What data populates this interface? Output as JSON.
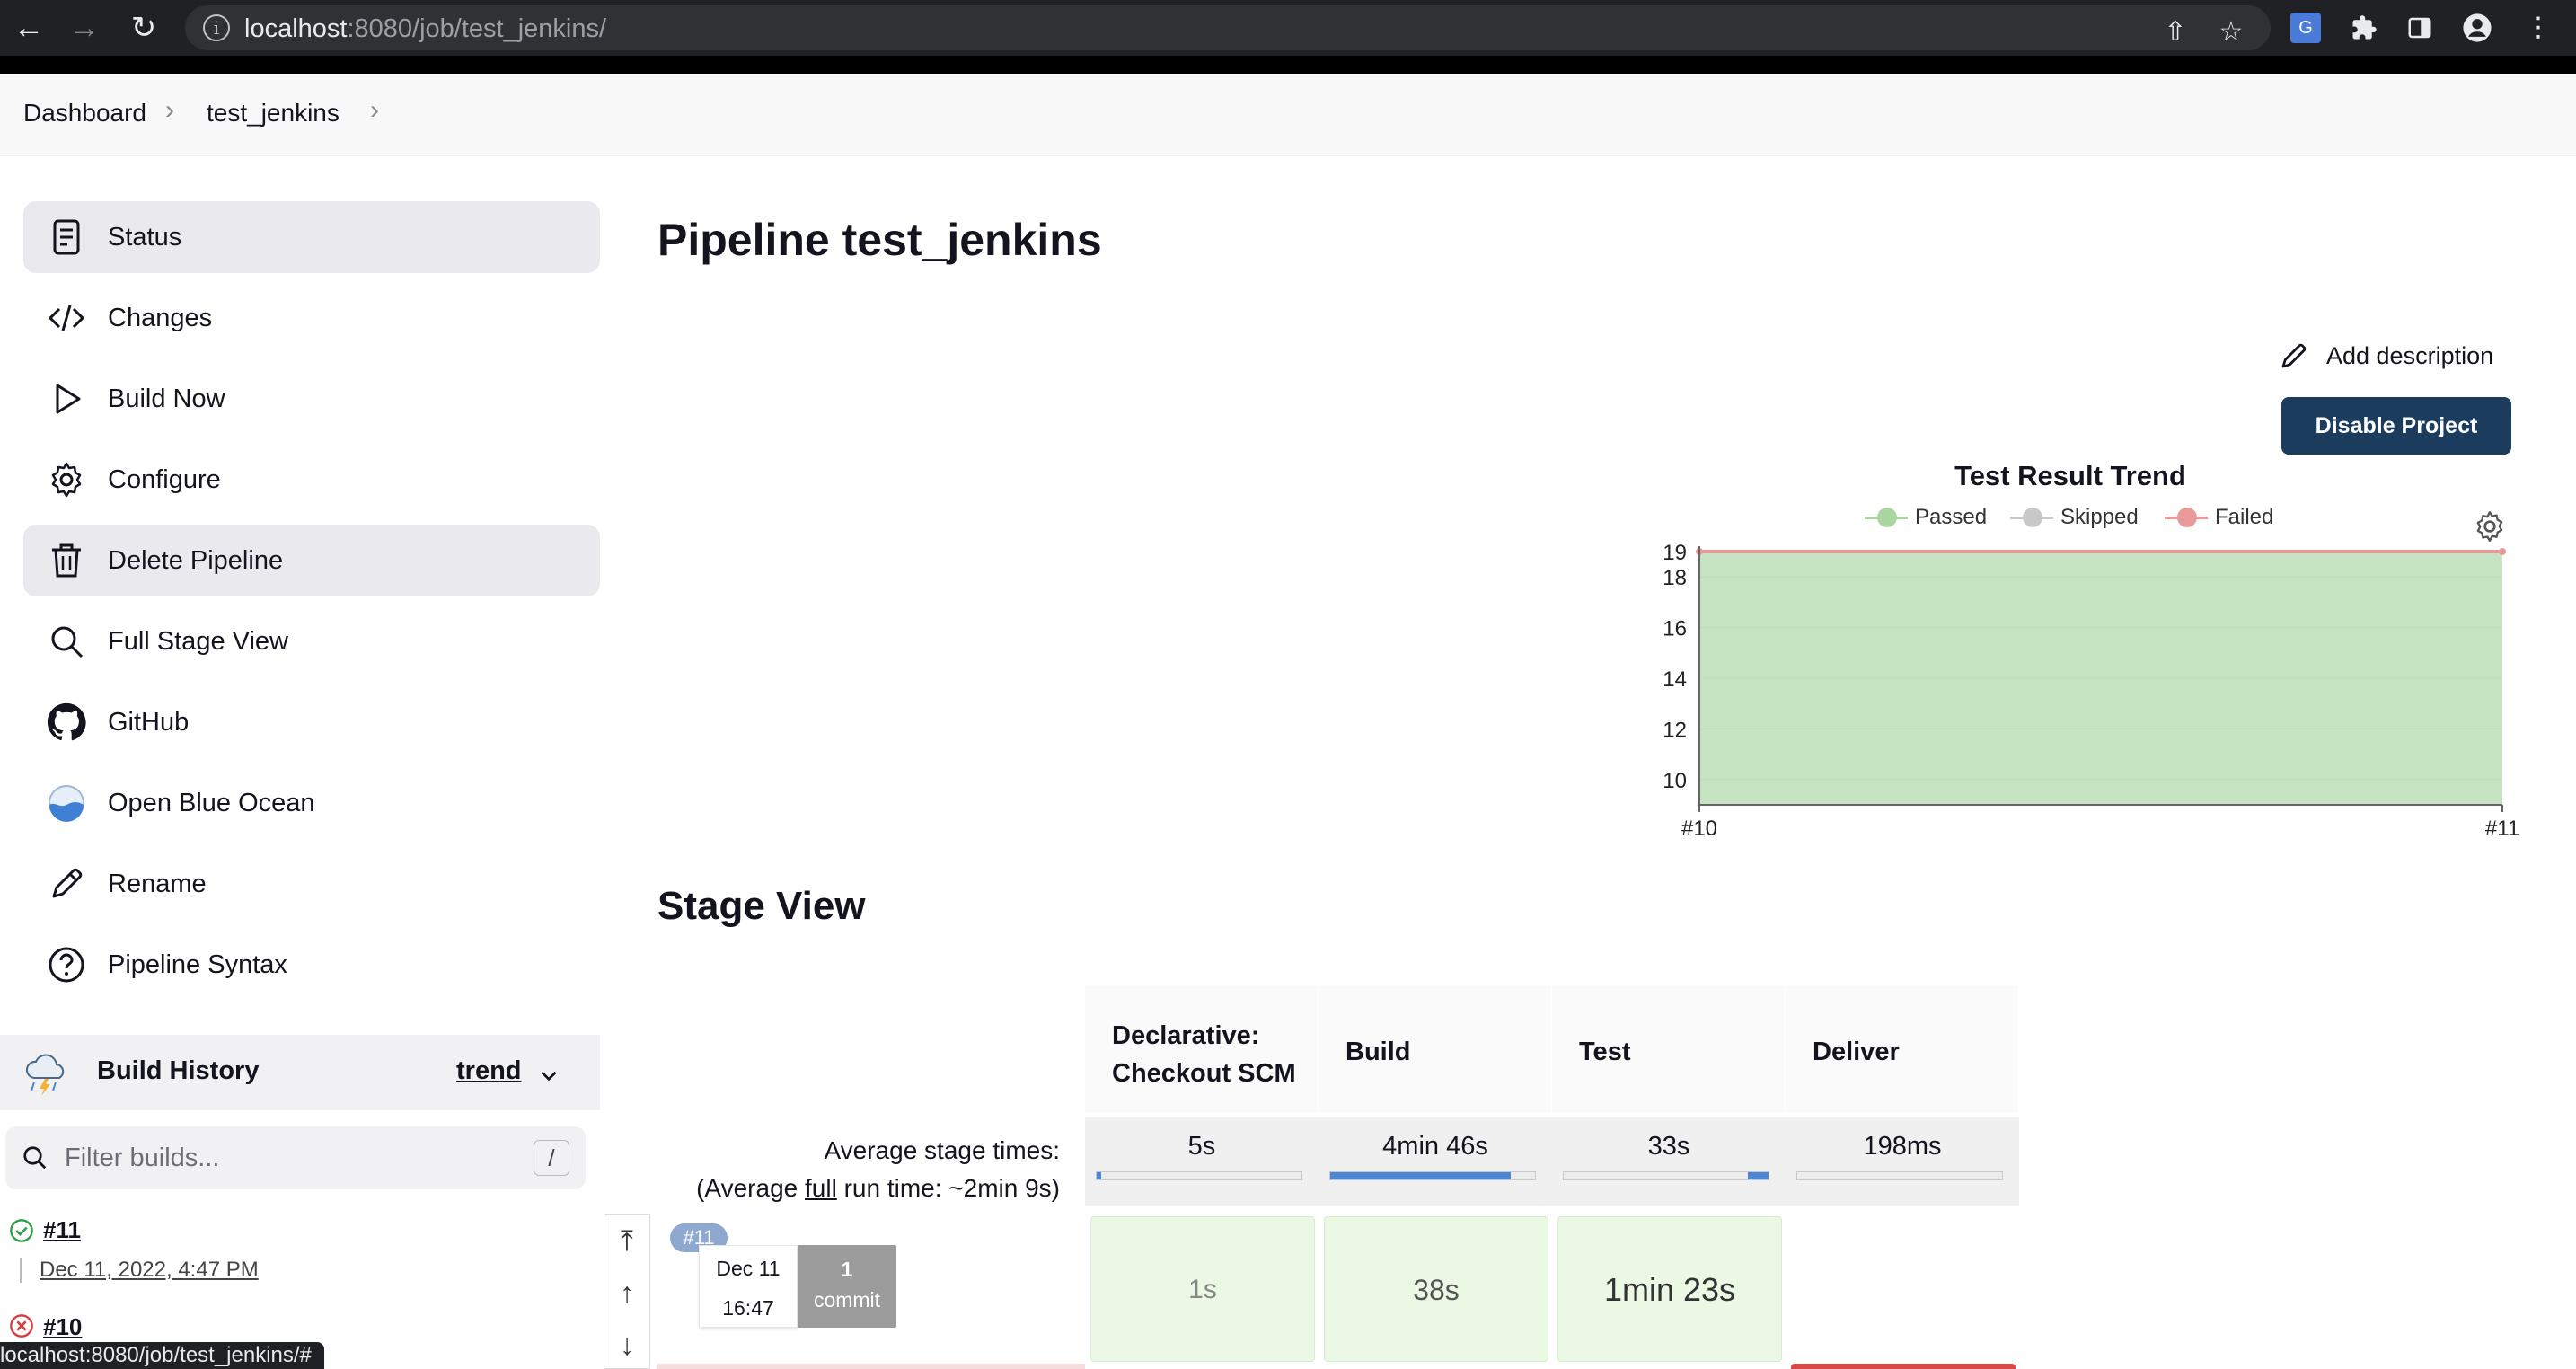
{
  "browser": {
    "url_host": "localhost",
    "url_rest": ":8080/job/test_jenkins/",
    "status_url": "localhost:8080/job/test_jenkins/#"
  },
  "breadcrumb": [
    "Dashboard",
    "test_jenkins"
  ],
  "sidebar": {
    "items": [
      {
        "label": "Status",
        "icon": "document-icon"
      },
      {
        "label": "Changes",
        "icon": "code-icon"
      },
      {
        "label": "Build Now",
        "icon": "play-icon"
      },
      {
        "label": "Configure",
        "icon": "gear-icon"
      },
      {
        "label": "Delete Pipeline",
        "icon": "trash-icon"
      },
      {
        "label": "Full Stage View",
        "icon": "search-icon"
      },
      {
        "label": "GitHub",
        "icon": "github-icon"
      },
      {
        "label": "Open Blue Ocean",
        "icon": "blue-ocean-icon"
      },
      {
        "label": "Rename",
        "icon": "pencil-icon"
      },
      {
        "label": "Pipeline Syntax",
        "icon": "help-icon"
      }
    ]
  },
  "build_history": {
    "title": "Build History",
    "trend_label": "trend",
    "filter_placeholder": "Filter builds...",
    "filter_shortcut": "/",
    "builds": [
      {
        "number": "#11",
        "date": "Dec 11, 2022, 4:47 PM",
        "status": "success"
      },
      {
        "number": "#10",
        "date": "",
        "status": "failed"
      }
    ]
  },
  "main": {
    "title": "Pipeline test_jenkins",
    "add_description": "Add description",
    "disable_button": "Disable Project"
  },
  "chart_data": {
    "type": "area",
    "title": "Test Result Trend",
    "legend": [
      "Passed",
      "Skipped",
      "Failed"
    ],
    "legend_placement": "top",
    "colors": {
      "Passed": "#a8d5a0",
      "Skipped": "#c8c8c8",
      "Failed": "#e89a9a"
    },
    "categories": [
      "#10",
      "#11"
    ],
    "series": [
      {
        "name": "Passed",
        "values": [
          19,
          19
        ]
      },
      {
        "name": "Skipped",
        "values": [
          0,
          0
        ]
      },
      {
        "name": "Failed",
        "values": [
          0,
          0
        ]
      }
    ],
    "y_ticks": [
      10,
      12,
      14,
      16,
      18,
      19
    ],
    "ylim": [
      9,
      19
    ],
    "xlabel": "",
    "ylabel": "",
    "grid": true
  },
  "stage_view": {
    "title": "Stage View",
    "avg_label_line1": "Average stage times:",
    "avg_label_prefix": "(Average ",
    "avg_label_full": "full",
    "avg_label_suffix": " run time: ~2min 9s)",
    "stages": [
      {
        "name": "Declarative: Checkout SCM",
        "avg": "5s",
        "avg_fraction": 0.02
      },
      {
        "name": "Build",
        "avg": "4min 46s",
        "avg_fraction": 0.88
      },
      {
        "name": "Test",
        "avg": "33s",
        "avg_fraction": 0.1
      },
      {
        "name": "Deliver",
        "avg": "198ms",
        "avg_fraction": 0.0
      }
    ],
    "runs": [
      {
        "badge": "#11",
        "date": "Dec 11",
        "time": "16:47",
        "commits": "1",
        "commits_word": "commit",
        "durations": [
          "1s",
          "38s",
          "1min 23s",
          ""
        ]
      }
    ]
  }
}
